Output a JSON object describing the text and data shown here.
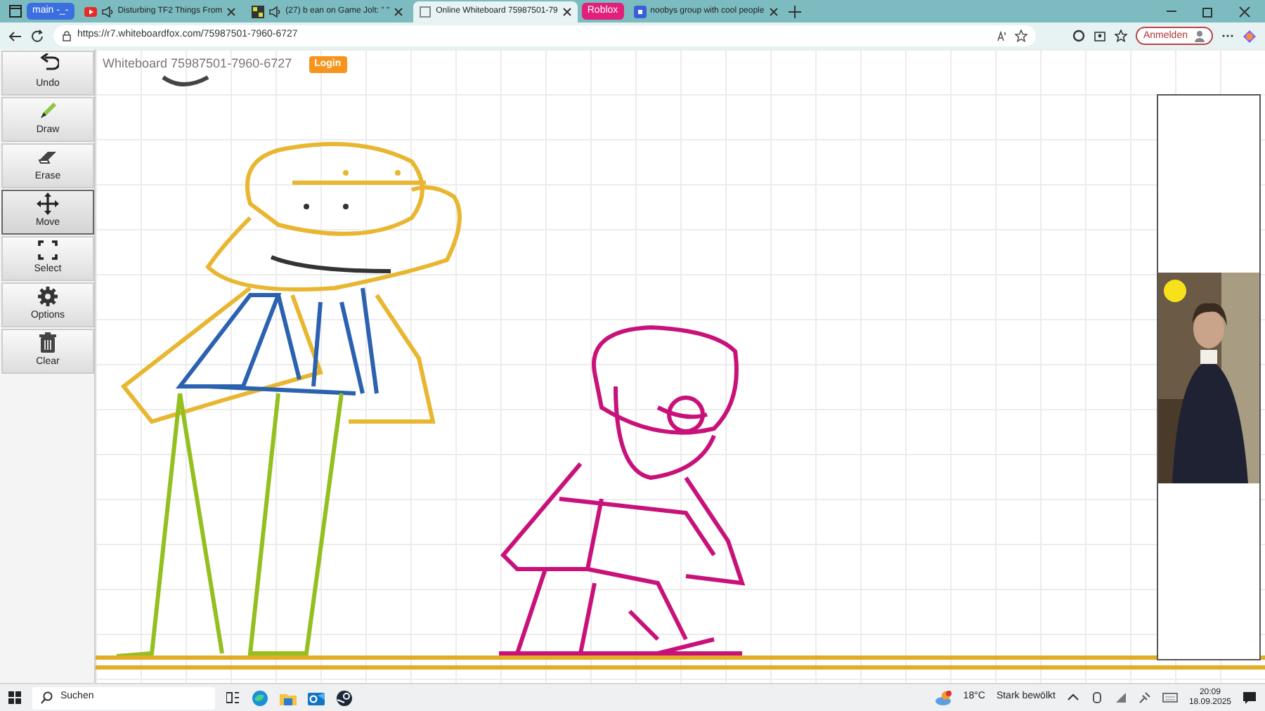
{
  "browser": {
    "tabs": [
      {
        "kind": "group",
        "label": "main -_-",
        "color": "#3b6fe0"
      },
      {
        "kind": "tab",
        "label": "Disturbing TF2 Things From",
        "selected": false,
        "audio": true
      },
      {
        "kind": "tab",
        "label": "(27) b ean on Game Jolt: \" \"",
        "selected": false,
        "audio": true
      },
      {
        "kind": "tab",
        "label": "Online Whiteboard 75987501-79",
        "selected": true,
        "audio": false
      },
      {
        "kind": "group",
        "label": "Roblox",
        "color": "#e0207a"
      },
      {
        "kind": "tab",
        "label": "noobys group with cool people",
        "selected": false,
        "audio": false
      }
    ],
    "url": "https://r7.whiteboardfox.com/75987501-7960-6727",
    "profile_button": "Anmelden"
  },
  "whiteboard": {
    "title": "Whiteboard 75987501-7960-6727",
    "login": "Login",
    "tools": [
      {
        "label": "Undo",
        "selected": false
      },
      {
        "label": "Draw",
        "selected": false
      },
      {
        "label": "Erase",
        "selected": false
      },
      {
        "label": "Move",
        "selected": true
      },
      {
        "label": "Select",
        "selected": false
      },
      {
        "label": "Options",
        "selected": false
      },
      {
        "label": "Clear",
        "selected": false
      }
    ]
  },
  "taskbar": {
    "search": "Suchen",
    "temperature": "18°C",
    "weather": "Stark bewölkt",
    "time": "20:09",
    "date": "18.09.2025"
  }
}
